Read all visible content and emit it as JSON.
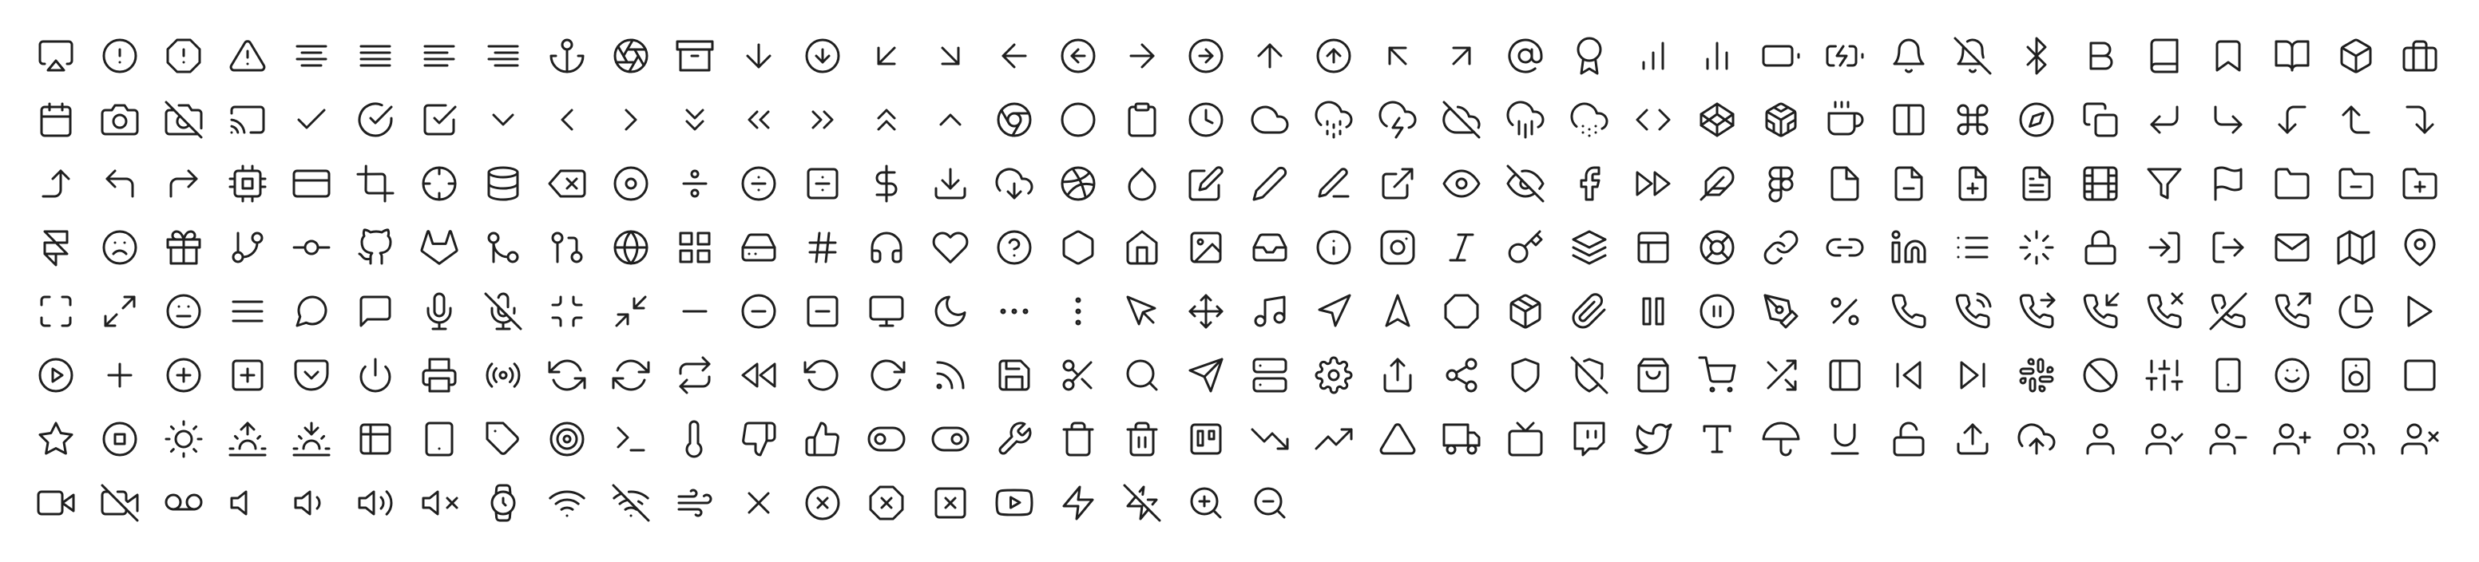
{
  "page": {
    "background": "#ffffff",
    "icon_color": "#1f1f1f"
  },
  "icons": [
    "airplay",
    "alert-circle",
    "alert-octagon",
    "alert-triangle",
    "align-center",
    "align-justify",
    "align-left",
    "align-right",
    "anchor",
    "aperture",
    "archive",
    "arrow-down",
    "arrow-down-circle",
    "arrow-down-left",
    "arrow-down-right",
    "arrow-left",
    "arrow-left-circle",
    "arrow-right",
    "arrow-right-circle",
    "arrow-up",
    "arrow-up-circle",
    "arrow-up-left",
    "arrow-up-right",
    "at-sign",
    "award",
    "bar-chart",
    "bar-chart-2",
    "battery",
    "battery-charging",
    "bell",
    "bell-off",
    "bluetooth",
    "bold",
    "book",
    "bookmark",
    "book-open",
    "box",
    "briefcase",
    "calendar",
    "camera",
    "camera-off",
    "cast",
    "check",
    "check-circle",
    "check-square",
    "chevron-down",
    "chevron-left",
    "chevron-right",
    "chevrons-down",
    "chevrons-left",
    "chevrons-right",
    "chevrons-up",
    "chevron-up",
    "chrome",
    "circle",
    "clipboard",
    "clock",
    "cloud",
    "cloud-drizzle",
    "cloud-lightning",
    "cloud-off",
    "cloud-rain",
    "cloud-snow",
    "code",
    "codepen",
    "codesandbox",
    "coffee",
    "columns",
    "command",
    "compass",
    "copy",
    "corner-down-left",
    "corner-down-right",
    "corner-left-down",
    "corner-left-up",
    "corner-right-down",
    "corner-right-up",
    "corner-up-left",
    "corner-up-right",
    "cpu",
    "credit-card",
    "crop",
    "crosshair",
    "database",
    "delete",
    "disc",
    "divide",
    "divide-circle",
    "divide-square",
    "dollar-sign",
    "download",
    "download-cloud",
    "dribbble",
    "droplet",
    "edit",
    "edit-2",
    "edit-3",
    "external-link",
    "eye",
    "eye-off",
    "facebook",
    "fast-forward",
    "feather",
    "figma",
    "file",
    "file-minus",
    "file-plus",
    "file-text",
    "film",
    "filter",
    "flag",
    "folder",
    "folder-minus",
    "folder-plus",
    "framer",
    "frown",
    "gift",
    "git-branch",
    "git-commit",
    "github",
    "gitlab",
    "git-merge",
    "git-pull-request",
    "globe",
    "grid",
    "hard-drive",
    "hash",
    "headphones",
    "heart",
    "help-circle",
    "hexagon",
    "home",
    "image",
    "inbox",
    "info",
    "instagram",
    "italic",
    "key",
    "layers",
    "layout",
    "life-buoy",
    "link",
    "link-2",
    "linkedin",
    "list",
    "loader",
    "lock",
    "log-in",
    "log-out",
    "mail",
    "map",
    "map-pin",
    "maximize",
    "maximize-2",
    "meh",
    "menu",
    "message-circle",
    "message-square",
    "mic",
    "mic-off",
    "minimize",
    "minimize-2",
    "minus",
    "minus-circle",
    "minus-square",
    "monitor",
    "moon",
    "more-horizontal",
    "more-vertical",
    "mouse-pointer",
    "move",
    "music",
    "navigation",
    "navigation-2",
    "octagon",
    "package",
    "paperclip",
    "pause",
    "pause-circle",
    "pen-tool",
    "percent",
    "phone",
    "phone-call",
    "phone-forwarded",
    "phone-incoming",
    "phone-missed",
    "phone-off",
    "phone-outgoing",
    "pie-chart",
    "play",
    "play-circle",
    "plus",
    "plus-circle",
    "plus-square",
    "pocket",
    "power",
    "printer",
    "radio",
    "refresh-ccw",
    "refresh-cw",
    "repeat",
    "rewind",
    "rotate-ccw",
    "rotate-cw",
    "rss",
    "save",
    "scissors",
    "search",
    "send",
    "server",
    "settings",
    "share",
    "share-2",
    "shield",
    "shield-off",
    "shopping-bag",
    "shopping-cart",
    "shuffle",
    "sidebar",
    "skip-back",
    "skip-forward",
    "slack",
    "slash",
    "sliders",
    "smartphone",
    "smile",
    "speaker",
    "square",
    "star",
    "stop-circle",
    "sun",
    "sunrise",
    "sunset",
    "table",
    "tablet",
    "tag",
    "target",
    "terminal",
    "thermometer",
    "thumbs-down",
    "thumbs-up",
    "toggle-left",
    "toggle-right",
    "tool",
    "trash",
    "trash-2",
    "trello",
    "trending-down",
    "trending-up",
    "triangle",
    "truck",
    "tv",
    "twitch",
    "twitter",
    "type",
    "umbrella",
    "underline",
    "unlock",
    "upload",
    "upload-cloud",
    "user",
    "user-check",
    "user-minus",
    "user-plus",
    "users",
    "user-x",
    "video",
    "video-off",
    "voicemail",
    "volume",
    "volume-1",
    "volume-2",
    "volume-x",
    "watch",
    "wifi",
    "wifi-off",
    "wind",
    "x",
    "x-circle",
    "x-octagon",
    "x-square",
    "youtube",
    "zap",
    "zap-off",
    "zoom-in",
    "zoom-out"
  ]
}
